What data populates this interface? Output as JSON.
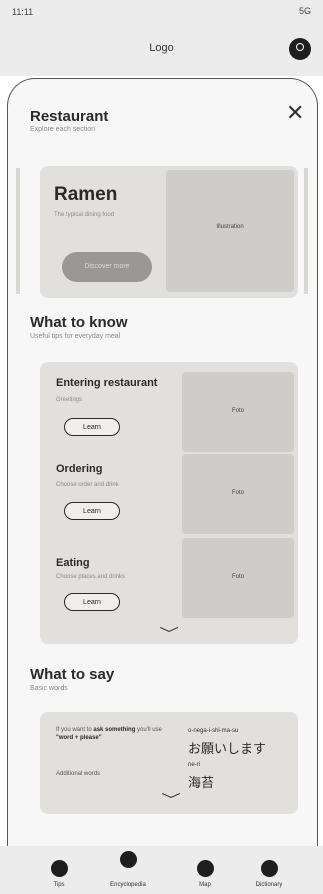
{
  "status_bar": {
    "time": "11:11",
    "system": "5G"
  },
  "app_bar": {
    "logo": "Logo"
  },
  "sheet": {
    "title": "Restaurant",
    "subtitle": "Explore each section"
  },
  "hero": {
    "title": "Ramen",
    "description": "The typical dining food",
    "image_label": "Illustration",
    "button_label": "Discover more"
  },
  "what_to_know": {
    "title": "What to know",
    "subtitle": "Useful tips for everyday meal",
    "items": [
      {
        "title": "Entering restaurant",
        "subtitle": "Greetings",
        "button": "Learn",
        "image_label": "Foto"
      },
      {
        "title": "Ordering",
        "subtitle": "Choose order and drink",
        "button": "Learn",
        "image_label": "Foto"
      },
      {
        "title": "Eating",
        "subtitle": "Choose places and drinks",
        "button": "Learn",
        "image_label": "Foto"
      }
    ]
  },
  "what_to_say": {
    "title": "What to say",
    "subtitle": "Basic words",
    "left_text_prefix": "If you want to ",
    "left_text_bold": "ask something",
    "left_text_mid": " you'll use ",
    "left_text_quote": "\"word + please\"",
    "left_note": "Additional words",
    "phrase_romaji": "o-nega-i-shi-ma-su",
    "phrase_jp": "お願いします",
    "word_romaji": "ne-ri",
    "word_jp": "海苔"
  },
  "tab_bar": {
    "tabs": [
      {
        "label": "Tips"
      },
      {
        "label": "Encyclopedia"
      },
      {
        "label": "Map"
      },
      {
        "label": "Dictionary"
      }
    ]
  }
}
